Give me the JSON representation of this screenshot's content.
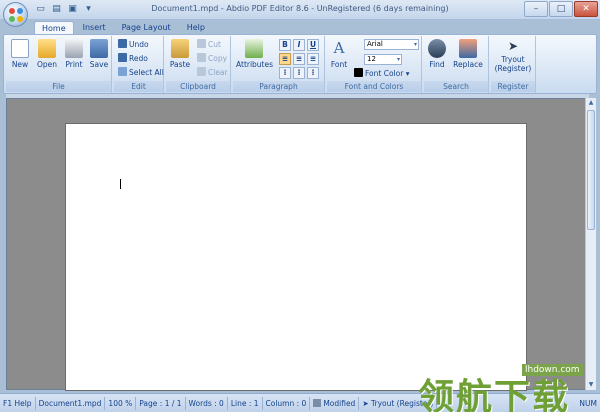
{
  "window": {
    "title": "Document1.mpd - Abdio PDF Editor 8.6 - UnRegistered (6 days remaining)",
    "minimize": "–",
    "maximize": "□",
    "close": "✕"
  },
  "quick_access": [
    "new-icon",
    "open-icon",
    "save-icon",
    "dropdown-icon"
  ],
  "tabs": [
    {
      "label": "Home",
      "active": true
    },
    {
      "label": "Insert",
      "active": false
    },
    {
      "label": "Page Layout",
      "active": false
    },
    {
      "label": "Help",
      "active": false
    }
  ],
  "ribbon": {
    "file": {
      "label": "File",
      "new": "New",
      "open": "Open",
      "print": "Print",
      "save": "Save"
    },
    "edit": {
      "label": "Edit",
      "undo": "Undo",
      "redo": "Redo",
      "select_all": "Select All"
    },
    "clipboard": {
      "label": "Clipboard",
      "paste": "Paste",
      "cut": "Cut",
      "copy": "Copy",
      "clear": "Clear"
    },
    "paragraph": {
      "label": "Paragraph",
      "attributes": "Attributes",
      "bold": "B",
      "italic": "I",
      "underline": "U"
    },
    "font": {
      "label": "Font and Colors",
      "font": "Font",
      "font_name": "Arial",
      "font_size": "12",
      "font_color": "Font Color",
      "font_color_value": "#000000"
    },
    "search": {
      "label": "Search",
      "find": "Find",
      "replace": "Replace"
    },
    "register": {
      "label": "Register",
      "tryout": "Tryout",
      "tryout_sub": "(Register)"
    }
  },
  "statusbar": {
    "help": "F1 Help",
    "document": "Document1.mpd",
    "zoom": "100 %",
    "page": "Page : 1 / 1",
    "words": "Words : 0",
    "line": "Line : 1",
    "column": "Column : 0",
    "modified": "Modified",
    "tryout": "Tryout (Register)",
    "num": "NUM"
  },
  "watermark": {
    "text": "领航下载",
    "url": "lhdown.com"
  },
  "colors": {
    "accent": "#15428b",
    "ribbon_bg": "#dbe7f5",
    "workspace": "#8c8c8c",
    "watermark": "#6ea036"
  }
}
